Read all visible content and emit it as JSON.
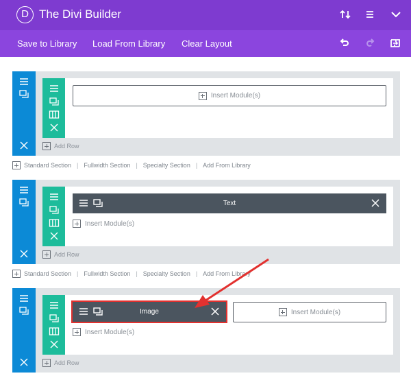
{
  "header": {
    "logo_letter": "D",
    "title": "The Divi Builder",
    "icons": [
      "sort-arrows-icon",
      "menu-icon",
      "chevron-down-icon"
    ]
  },
  "toolbar": {
    "save_label": "Save to Library",
    "load_label": "Load From Library",
    "clear_label": "Clear Layout",
    "icons": [
      "undo-icon",
      "redo-icon",
      "portability-icon"
    ]
  },
  "add_row_label": "Add Row",
  "section_links": [
    "Standard Section",
    "Fullwidth Section",
    "Specialty Section",
    "Add From Library"
  ],
  "sections": [
    {
      "row": {
        "modules": [],
        "insert_label": "Insert Module(s)"
      }
    },
    {
      "row": {
        "modules": [
          {
            "label": "Text"
          }
        ],
        "insert_label": "Insert Module(s)"
      }
    },
    {
      "row": {
        "modules": [
          {
            "label": "Image",
            "selected": true
          }
        ],
        "insert_label": "Insert Module(s)",
        "second_column_insert_label": "Insert Module(s)"
      }
    }
  ],
  "colors": {
    "header": "#7e3bd0",
    "toolbar": "#8b45de",
    "section_handle": "#0c8ad6",
    "row_handle": "#1dbc9b",
    "module": "#4b555f",
    "annotation": "#e2312f"
  }
}
